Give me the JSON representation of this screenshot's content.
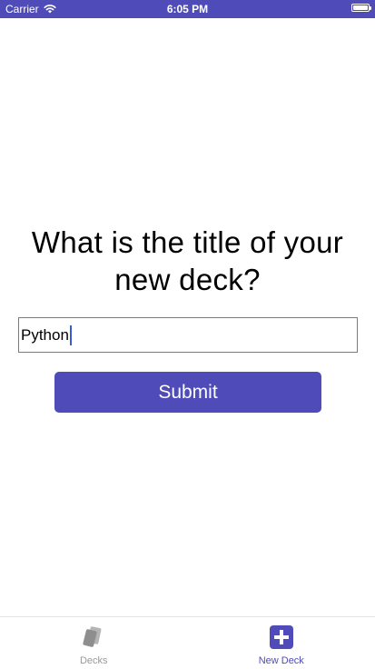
{
  "status_bar": {
    "carrier": "Carrier",
    "time": "6:05 PM",
    "icons": [
      "wifi-icon",
      "battery-icon"
    ],
    "background": "#4f4bb8"
  },
  "form": {
    "question": "What is the title of your new deck?",
    "input_value": "Python",
    "submit_label": "Submit",
    "accent": "#4f4bb8"
  },
  "tab_bar": {
    "tabs": [
      {
        "label": "Decks",
        "icon": "cards-icon",
        "active": false
      },
      {
        "label": "New Deck",
        "icon": "plus-square-icon",
        "active": true
      }
    ],
    "active_color": "#4f4bb8",
    "inactive_color": "#9a9a9a"
  }
}
